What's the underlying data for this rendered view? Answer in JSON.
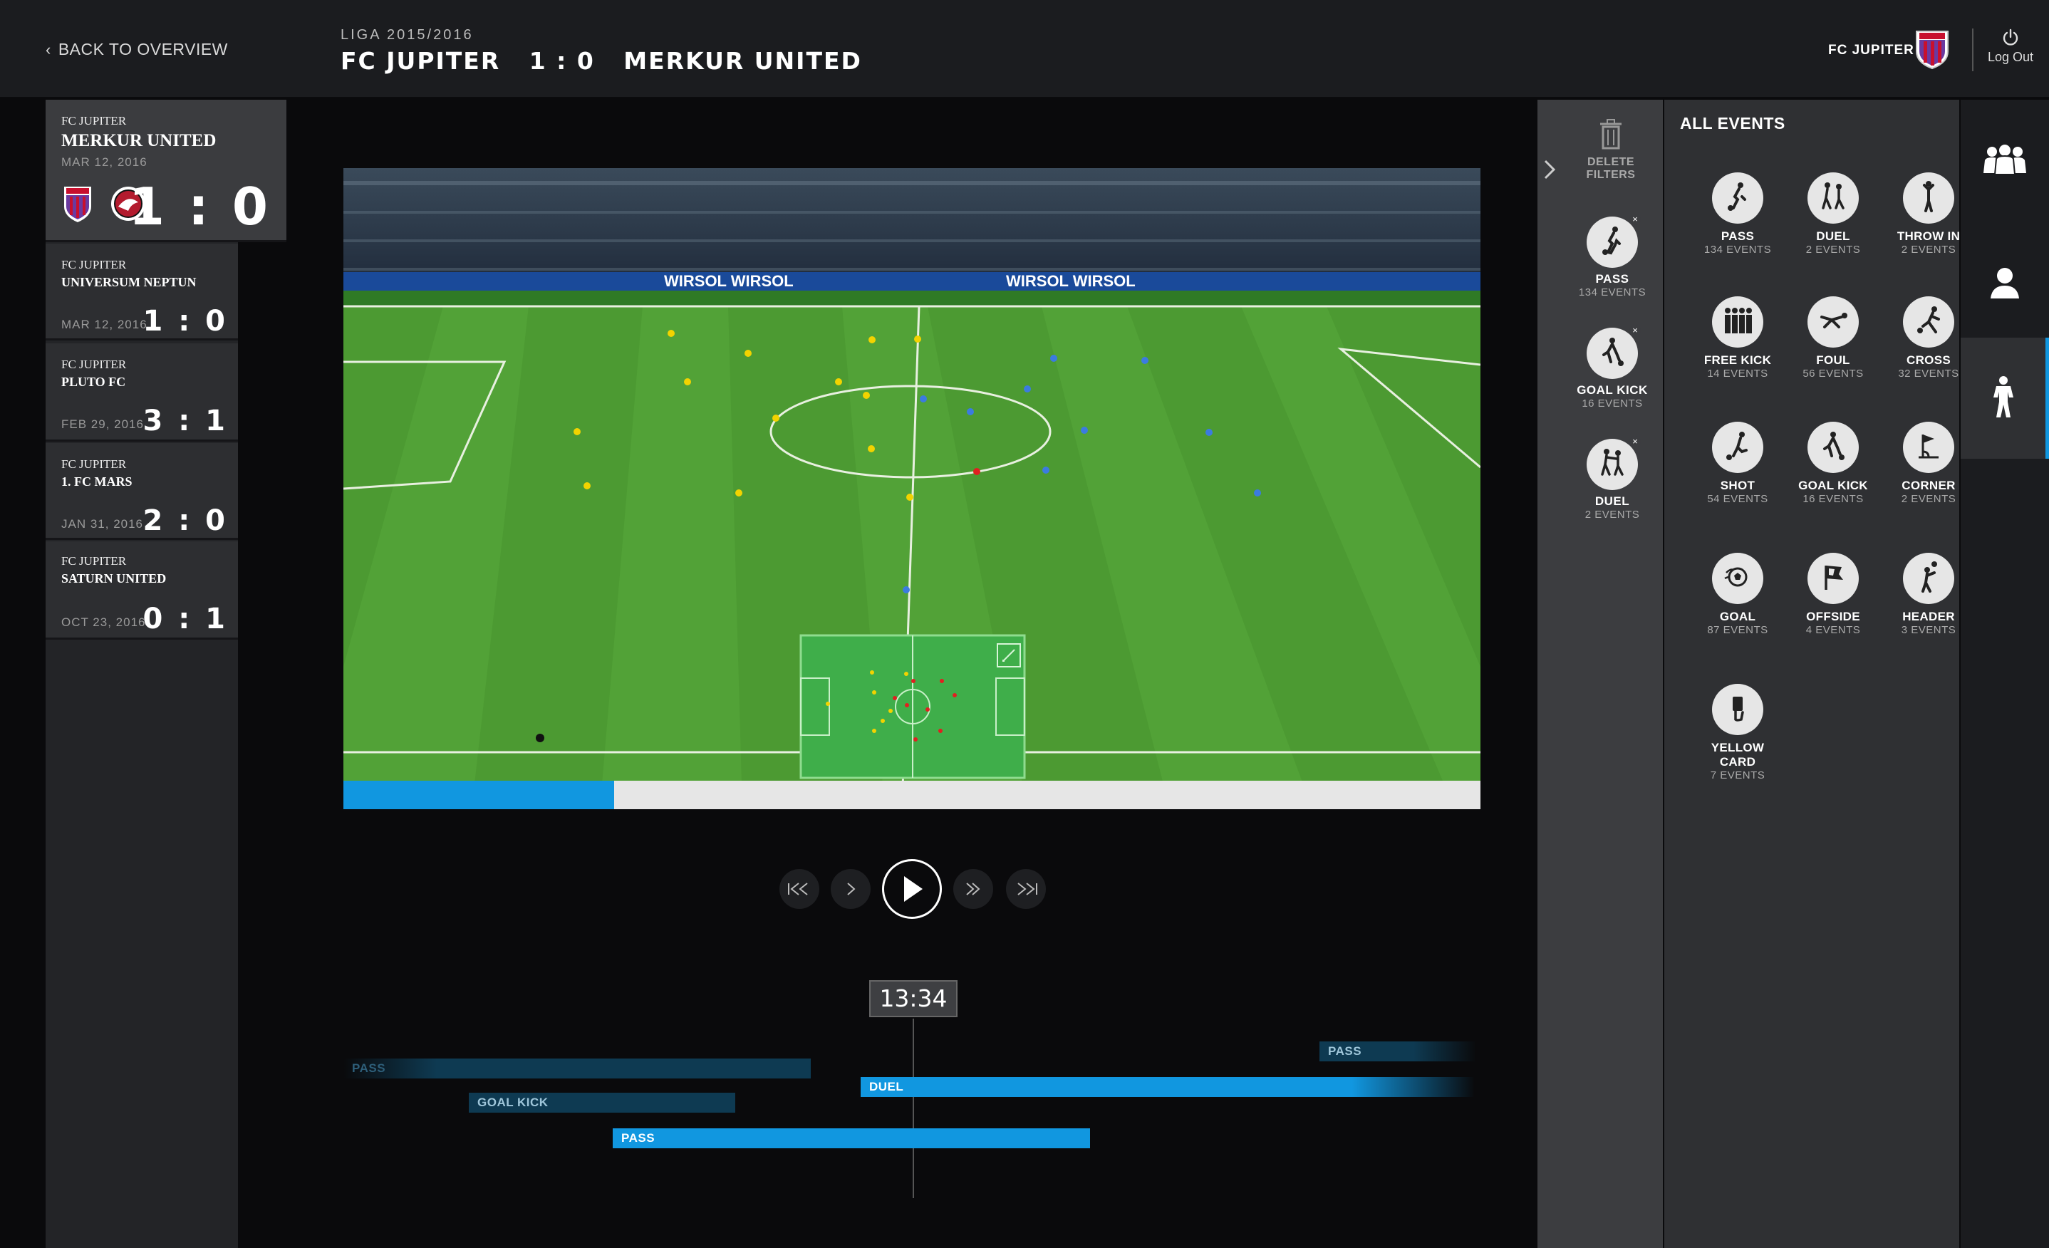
{
  "header": {
    "back_label": "BACK TO OVERVIEW",
    "league": "LIGA 2015/2016",
    "match_title": "FC JUPITER   1 : 0   MERKUR UNITED",
    "club_name": "FC JUPITER",
    "logout_label": "Log Out"
  },
  "matches": [
    {
      "team1": "FC JUPITER",
      "team2": "MERKUR UNITED",
      "date": "MAR 12, 2016",
      "score": "1 : 0"
    },
    {
      "team1": "FC JUPITER",
      "team2": "UNIVERSUM NEPTUN",
      "date": "MAR 12, 2016",
      "score": "1 : 0"
    },
    {
      "team1": "FC JUPITER",
      "team2": "PLUTO FC",
      "date": "FEB 29, 2016",
      "score": "3 : 1"
    },
    {
      "team1": "FC JUPITER",
      "team2": "1. FC MARS",
      "date": "JAN 31, 2016",
      "score": "2 : 0"
    },
    {
      "team1": "FC JUPITER",
      "team2": "SATURN UNITED",
      "date": "OCT 23, 2016",
      "score": "0 : 1"
    }
  ],
  "video": {
    "banner_text": "WIRSOL WIRSOL",
    "banner_text_2": "WIRSOL WIRSOL",
    "progress_fraction": 0.238
  },
  "timeline": {
    "current_time": "13:34",
    "bars": [
      {
        "label": "PASS"
      },
      {
        "label": "PASS"
      },
      {
        "label": "DUEL"
      },
      {
        "label": "GOAL KICK"
      },
      {
        "label": "PASS"
      }
    ]
  },
  "filters": {
    "delete_label": "DELETE FILTERS",
    "active": [
      {
        "name": "PASS",
        "count": "134 EVENTS",
        "icon": "pass-icon"
      },
      {
        "name": "GOAL KICK",
        "count": "16 EVENTS",
        "icon": "goal-kick-icon"
      },
      {
        "name": "DUEL",
        "count": "2 EVENTS",
        "icon": "duel-icon"
      }
    ]
  },
  "events": {
    "title": "ALL EVENTS",
    "items": [
      {
        "name": "PASS",
        "count": "134 EVENTS",
        "icon": "pass-icon"
      },
      {
        "name": "DUEL",
        "count": "2 EVENTS",
        "icon": "duel-icon"
      },
      {
        "name": "THROW IN",
        "count": "2 EVENTS",
        "icon": "throw-in-icon"
      },
      {
        "name": "FREE KICK",
        "count": "14 EVENTS",
        "icon": "free-kick-icon"
      },
      {
        "name": "FOUL",
        "count": "56 EVENTS",
        "icon": "foul-icon"
      },
      {
        "name": "CROSS",
        "count": "32 EVENTS",
        "icon": "cross-icon"
      },
      {
        "name": "SHOT",
        "count": "54 EVENTS",
        "icon": "shot-icon"
      },
      {
        "name": "GOAL KICK",
        "count": "16 EVENTS",
        "icon": "goal-kick-icon"
      },
      {
        "name": "CORNER",
        "count": "2 EVENTS",
        "icon": "corner-icon"
      },
      {
        "name": "GOAL",
        "count": "87 EVENTS",
        "icon": "goal-icon"
      },
      {
        "name": "OFFSIDE",
        "count": "4 EVENTS",
        "icon": "offside-icon"
      },
      {
        "name": "HEADER",
        "count": "3 EVENTS",
        "icon": "header-icon"
      },
      {
        "name": "YELLOW CARD",
        "count": "7 EVENTS",
        "icon": "yellow-card-icon"
      }
    ]
  },
  "colors": {
    "accent": "#1197e0",
    "dark_accent": "#0e3a52"
  }
}
